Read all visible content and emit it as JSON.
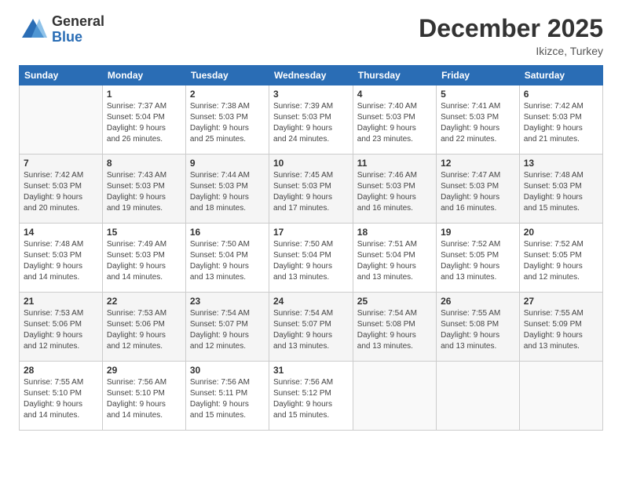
{
  "header": {
    "logo_general": "General",
    "logo_blue": "Blue",
    "month_title": "December 2025",
    "location": "Ikizce, Turkey"
  },
  "weekdays": [
    "Sunday",
    "Monday",
    "Tuesday",
    "Wednesday",
    "Thursday",
    "Friday",
    "Saturday"
  ],
  "weeks": [
    [
      {
        "day": "",
        "info": ""
      },
      {
        "day": "1",
        "info": "Sunrise: 7:37 AM\nSunset: 5:04 PM\nDaylight: 9 hours\nand 26 minutes."
      },
      {
        "day": "2",
        "info": "Sunrise: 7:38 AM\nSunset: 5:03 PM\nDaylight: 9 hours\nand 25 minutes."
      },
      {
        "day": "3",
        "info": "Sunrise: 7:39 AM\nSunset: 5:03 PM\nDaylight: 9 hours\nand 24 minutes."
      },
      {
        "day": "4",
        "info": "Sunrise: 7:40 AM\nSunset: 5:03 PM\nDaylight: 9 hours\nand 23 minutes."
      },
      {
        "day": "5",
        "info": "Sunrise: 7:41 AM\nSunset: 5:03 PM\nDaylight: 9 hours\nand 22 minutes."
      },
      {
        "day": "6",
        "info": "Sunrise: 7:42 AM\nSunset: 5:03 PM\nDaylight: 9 hours\nand 21 minutes."
      }
    ],
    [
      {
        "day": "7",
        "info": "Sunrise: 7:42 AM\nSunset: 5:03 PM\nDaylight: 9 hours\nand 20 minutes."
      },
      {
        "day": "8",
        "info": "Sunrise: 7:43 AM\nSunset: 5:03 PM\nDaylight: 9 hours\nand 19 minutes."
      },
      {
        "day": "9",
        "info": "Sunrise: 7:44 AM\nSunset: 5:03 PM\nDaylight: 9 hours\nand 18 minutes."
      },
      {
        "day": "10",
        "info": "Sunrise: 7:45 AM\nSunset: 5:03 PM\nDaylight: 9 hours\nand 17 minutes."
      },
      {
        "day": "11",
        "info": "Sunrise: 7:46 AM\nSunset: 5:03 PM\nDaylight: 9 hours\nand 16 minutes."
      },
      {
        "day": "12",
        "info": "Sunrise: 7:47 AM\nSunset: 5:03 PM\nDaylight: 9 hours\nand 16 minutes."
      },
      {
        "day": "13",
        "info": "Sunrise: 7:48 AM\nSunset: 5:03 PM\nDaylight: 9 hours\nand 15 minutes."
      }
    ],
    [
      {
        "day": "14",
        "info": "Sunrise: 7:48 AM\nSunset: 5:03 PM\nDaylight: 9 hours\nand 14 minutes."
      },
      {
        "day": "15",
        "info": "Sunrise: 7:49 AM\nSunset: 5:03 PM\nDaylight: 9 hours\nand 14 minutes."
      },
      {
        "day": "16",
        "info": "Sunrise: 7:50 AM\nSunset: 5:04 PM\nDaylight: 9 hours\nand 13 minutes."
      },
      {
        "day": "17",
        "info": "Sunrise: 7:50 AM\nSunset: 5:04 PM\nDaylight: 9 hours\nand 13 minutes."
      },
      {
        "day": "18",
        "info": "Sunrise: 7:51 AM\nSunset: 5:04 PM\nDaylight: 9 hours\nand 13 minutes."
      },
      {
        "day": "19",
        "info": "Sunrise: 7:52 AM\nSunset: 5:05 PM\nDaylight: 9 hours\nand 13 minutes."
      },
      {
        "day": "20",
        "info": "Sunrise: 7:52 AM\nSunset: 5:05 PM\nDaylight: 9 hours\nand 12 minutes."
      }
    ],
    [
      {
        "day": "21",
        "info": "Sunrise: 7:53 AM\nSunset: 5:06 PM\nDaylight: 9 hours\nand 12 minutes."
      },
      {
        "day": "22",
        "info": "Sunrise: 7:53 AM\nSunset: 5:06 PM\nDaylight: 9 hours\nand 12 minutes."
      },
      {
        "day": "23",
        "info": "Sunrise: 7:54 AM\nSunset: 5:07 PM\nDaylight: 9 hours\nand 12 minutes."
      },
      {
        "day": "24",
        "info": "Sunrise: 7:54 AM\nSunset: 5:07 PM\nDaylight: 9 hours\nand 13 minutes."
      },
      {
        "day": "25",
        "info": "Sunrise: 7:54 AM\nSunset: 5:08 PM\nDaylight: 9 hours\nand 13 minutes."
      },
      {
        "day": "26",
        "info": "Sunrise: 7:55 AM\nSunset: 5:08 PM\nDaylight: 9 hours\nand 13 minutes."
      },
      {
        "day": "27",
        "info": "Sunrise: 7:55 AM\nSunset: 5:09 PM\nDaylight: 9 hours\nand 13 minutes."
      }
    ],
    [
      {
        "day": "28",
        "info": "Sunrise: 7:55 AM\nSunset: 5:10 PM\nDaylight: 9 hours\nand 14 minutes."
      },
      {
        "day": "29",
        "info": "Sunrise: 7:56 AM\nSunset: 5:10 PM\nDaylight: 9 hours\nand 14 minutes."
      },
      {
        "day": "30",
        "info": "Sunrise: 7:56 AM\nSunset: 5:11 PM\nDaylight: 9 hours\nand 15 minutes."
      },
      {
        "day": "31",
        "info": "Sunrise: 7:56 AM\nSunset: 5:12 PM\nDaylight: 9 hours\nand 15 minutes."
      },
      {
        "day": "",
        "info": ""
      },
      {
        "day": "",
        "info": ""
      },
      {
        "day": "",
        "info": ""
      }
    ]
  ]
}
